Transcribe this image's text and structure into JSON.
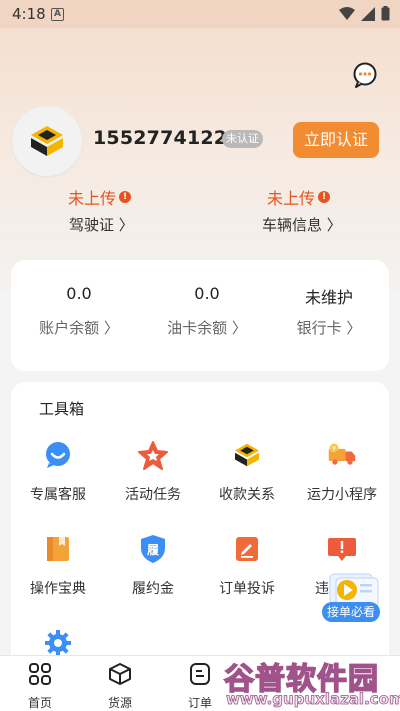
{
  "status_bar": {
    "time": "4:18",
    "notification_letter": "A"
  },
  "profile": {
    "phone": "15527741226",
    "verification_badge": "未认证",
    "verify_button": "立即认证"
  },
  "uploads": [
    {
      "status": "未上传",
      "label": "驾驶证 〉"
    },
    {
      "status": "未上传",
      "label": "车辆信息 〉"
    }
  ],
  "balances": [
    {
      "value": "0.0",
      "label": "账户余额 〉"
    },
    {
      "value": "0.0",
      "label": "油卡余额 〉"
    },
    {
      "value": "未维护",
      "label": "银行卡 〉"
    }
  ],
  "toolbox": {
    "title": "工具箱",
    "items": [
      {
        "label": "专属客服",
        "icon": "chat-bubble-icon"
      },
      {
        "label": "活动任务",
        "icon": "star-icon"
      },
      {
        "label": "收款关系",
        "icon": "logo-icon"
      },
      {
        "label": "运力小程序",
        "icon": "truck-icon"
      },
      {
        "label": "操作宝典",
        "icon": "book-icon"
      },
      {
        "label": "履约金",
        "icon": "shield-icon"
      },
      {
        "label": "订单投诉",
        "icon": "edit-icon"
      },
      {
        "label": "违",
        "icon": "alert-icon"
      },
      {
        "label": "",
        "icon": "gear-icon"
      }
    ]
  },
  "float_badge": {
    "label": "接单必看"
  },
  "tabs": [
    {
      "label": "首页",
      "icon": "home-grid-icon"
    },
    {
      "label": "货源",
      "icon": "cube-icon"
    },
    {
      "label": "订单",
      "icon": "order-icon"
    }
  ],
  "watermark": {
    "main": "谷普软件园",
    "url": "www.gupuxlazal.com"
  },
  "colors": {
    "accent": "#f28c33",
    "alert": "#e8541f",
    "header_bg": "#f3dccb"
  }
}
